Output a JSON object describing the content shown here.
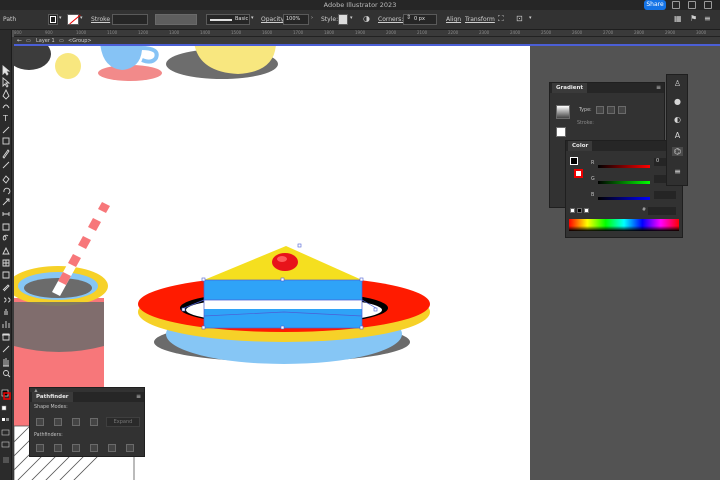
{
  "app": {
    "title": "Adobe Illustrator 2023",
    "share_label": "Share"
  },
  "controlbar": {
    "selection_label": "Path",
    "stroke_label": "Stroke",
    "brush_label": "Basic",
    "opacity_label": "Opacity:",
    "opacity_value": "100%",
    "style_label": "Style:",
    "corners_label": "Corners:",
    "corners_value": "0 px",
    "align_label": "Align",
    "transform_label": "Transform"
  },
  "ruler": {
    "ticks": [
      "800",
      "900",
      "1000",
      "1100",
      "1200",
      "1300",
      "1400",
      "1500",
      "1600",
      "1700",
      "1800",
      "1900",
      "2000",
      "2100",
      "2200",
      "2300",
      "2400",
      "2500",
      "2600",
      "2700",
      "2800",
      "2900",
      "3000"
    ]
  },
  "breadcrumb": {
    "layer": "Layer 1",
    "group": "<Group>"
  },
  "gradient_panel": {
    "title": "Gradient",
    "type_label": "Type:",
    "stroke_label": "Stroke:"
  },
  "color_panel": {
    "title": "Color",
    "r_label": "R",
    "r_value": "0",
    "g_label": "G",
    "b_label": "B",
    "hex_label": "#"
  },
  "pathfinder_panel": {
    "title": "Pathfinder",
    "shape_modes_label": "Shape Modes:",
    "expand_label": "Expand",
    "pathfinders_label": "Pathfinders:"
  },
  "colors": {
    "accent": "#1473e6",
    "selection_blue": "#4b5fd6",
    "plate_red": "#ff1a00",
    "cake_yellow": "#f5e020",
    "cream_blue": "#2fa3f7",
    "cherry_red": "#e8131a",
    "cup_pink": "#f7777a",
    "shadow_gray": "#6d6d6d",
    "light_blue": "#7fc6f5"
  }
}
